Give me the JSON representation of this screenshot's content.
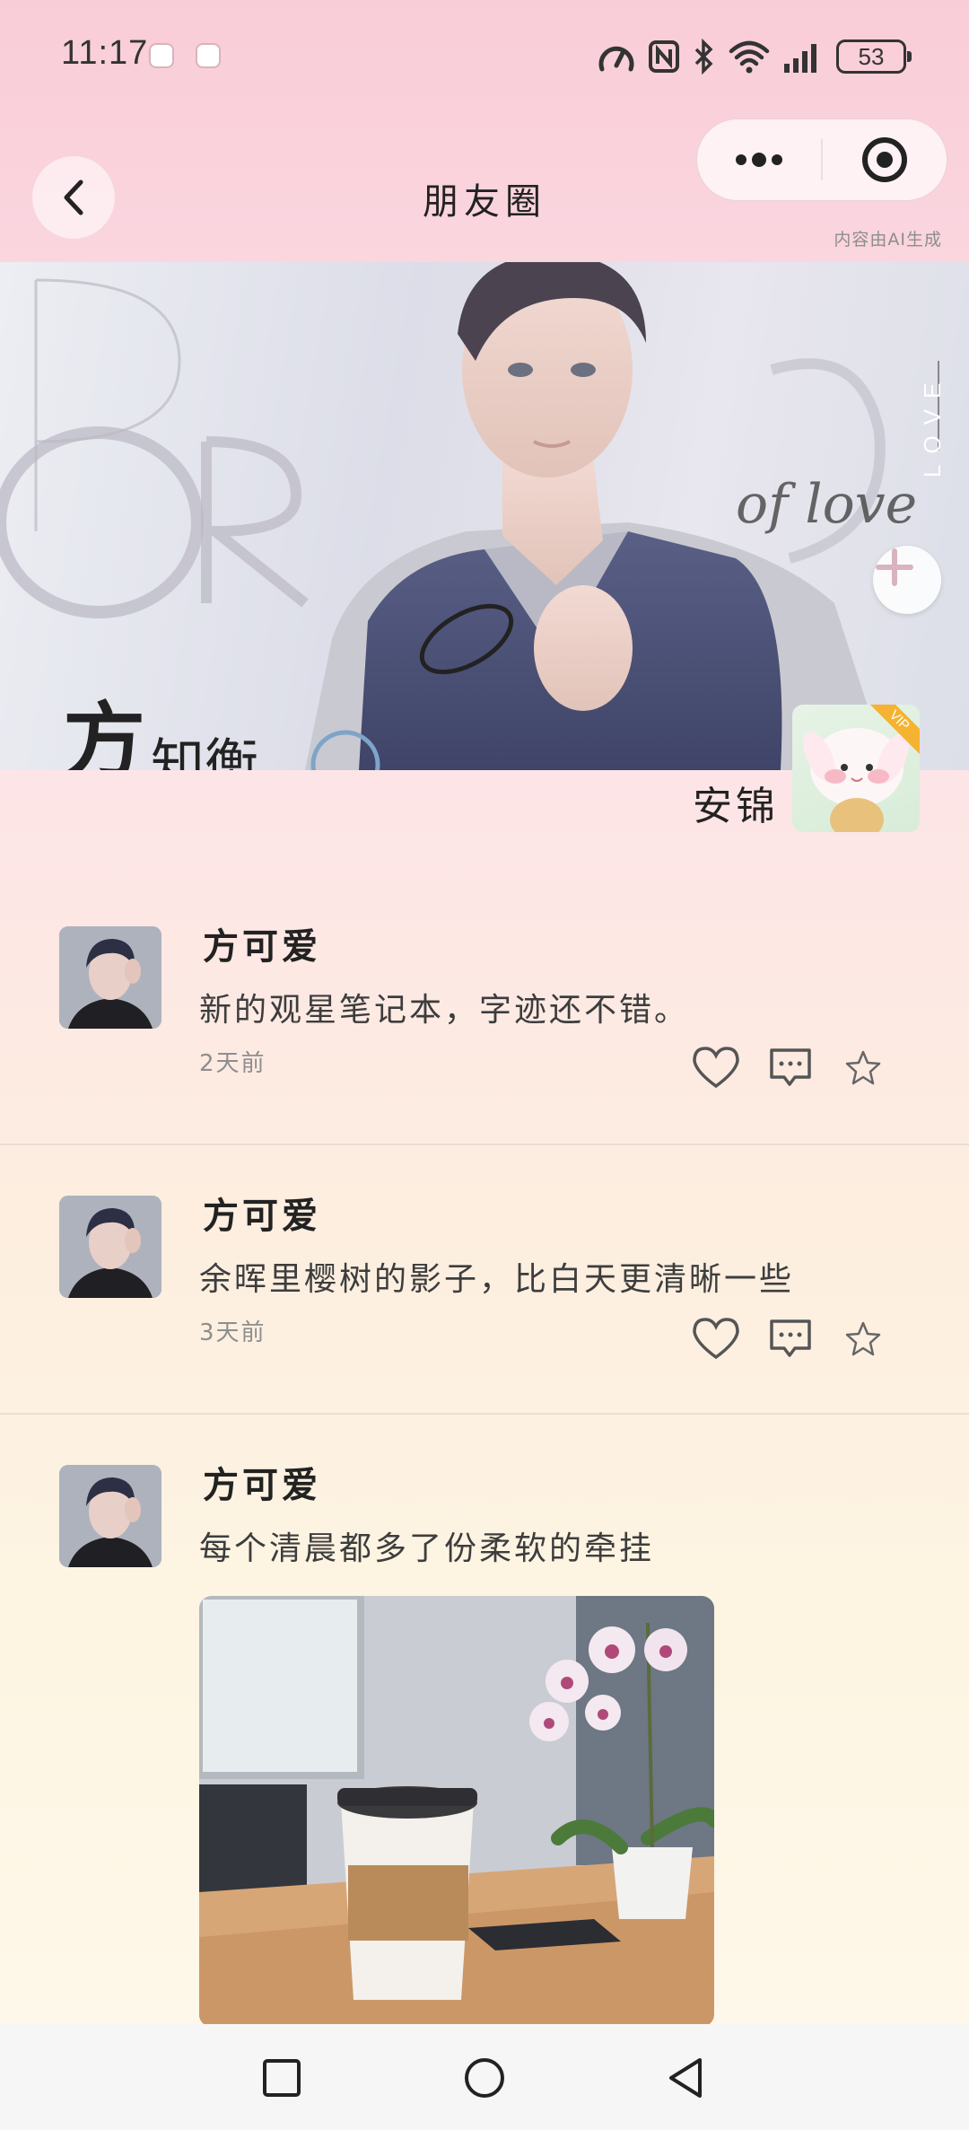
{
  "status_bar": {
    "time": "11:17",
    "battery": "53",
    "icons": [
      "speed-icon",
      "nfc-icon",
      "bluetooth-icon",
      "wifi-icon",
      "signal-icon",
      "battery-icon"
    ]
  },
  "header": {
    "title": "朋友圈",
    "back_icon": "chevron-left-icon",
    "more_icon": "more-dots-icon",
    "close_icon": "target-icon",
    "ai_notice": "内容由AI生成"
  },
  "cover": {
    "add_icon": "plus-icon",
    "owner_name": "安锦",
    "vip_label": "VIP"
  },
  "posts": [
    {
      "name": "方可爱",
      "text": "新的观星笔记本，字迹还不错。",
      "time": "2天前"
    },
    {
      "name": "方可爱",
      "text": "余晖里樱树的影子，比白天更清晰一些",
      "time": "3天前"
    },
    {
      "name": "方可爱",
      "text": "每个清晨都多了份柔软的牵挂"
    }
  ],
  "nav_bar": {
    "icons": [
      "recents-square-icon",
      "home-circle-icon",
      "back-triangle-icon"
    ]
  },
  "colors": {
    "header_pink": "#f9cdd8",
    "vip": "#f5b331",
    "text_dark": "#222222"
  }
}
